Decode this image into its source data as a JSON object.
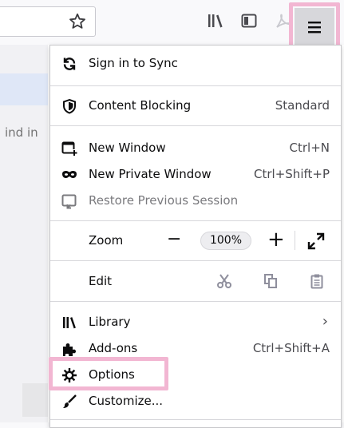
{
  "toolbar": {
    "bookmark_icon": "star-icon",
    "library_icon": "library-icon",
    "sidebar_icon": "sidebar-icon",
    "pdf_icon": "pdf-icon",
    "menu_icon": "hamburger-menu-icon"
  },
  "page": {
    "find_text": "ind in"
  },
  "menu": {
    "sign_in": "Sign in to Sync",
    "content_blocking": {
      "label": "Content Blocking",
      "value": "Standard"
    },
    "new_window": {
      "label": "New Window",
      "shortcut": "Ctrl+N"
    },
    "private_window": {
      "label": "New Private Window",
      "shortcut": "Ctrl+Shift+P"
    },
    "restore_session": "Restore Previous Session",
    "zoom": {
      "label": "Zoom",
      "minus": "−",
      "level": "100%",
      "plus": "+"
    },
    "edit": {
      "label": "Edit"
    },
    "library": "Library",
    "addons": {
      "label": "Add-ons",
      "shortcut": "Ctrl+Shift+A"
    },
    "options": "Options",
    "customize": "Customize..."
  },
  "colors": {
    "highlight": "#f2b6d2",
    "menu_button_active": "#d7d7db"
  }
}
